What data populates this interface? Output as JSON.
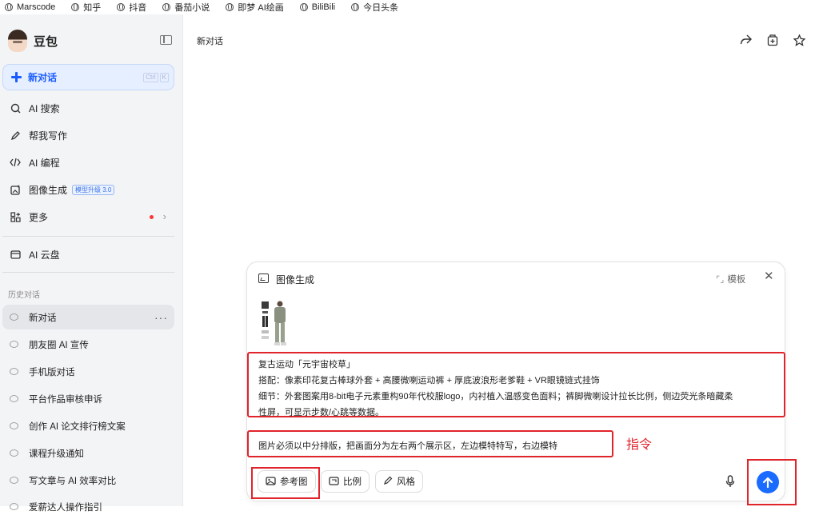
{
  "bookmarks": [
    "Marscode",
    "知乎",
    "抖音",
    "番茄小说",
    "即梦 AI绘画",
    "BiliBili",
    "今日头条"
  ],
  "sidebar": {
    "brand": "豆包",
    "new_chat": {
      "label": "新对话",
      "shortcut_keys": [
        "Ctrl",
        "K"
      ]
    },
    "items": [
      {
        "label": "AI 搜索",
        "icon": "ai-search-icon"
      },
      {
        "label": "帮我写作",
        "icon": "pen-icon"
      },
      {
        "label": "AI 编程",
        "icon": "code-icon"
      },
      {
        "label": "图像生成",
        "icon": "image-gen-icon",
        "badge": "模型升级 3.0"
      },
      {
        "label": "更多",
        "icon": "grid-icon"
      }
    ],
    "cloud": {
      "label": "AI 云盘",
      "icon": "cloud-drive-icon"
    },
    "history_title": "历史对话",
    "history": [
      "新对话",
      "朋友圈 AI 宣传",
      "手机版对话",
      "平台作品审核申诉",
      "创作 AI 论文排行榜文案",
      "课程升级通知",
      "写文章与 AI 效率对比",
      "爱薪达人操作指引"
    ]
  },
  "header": {
    "title": "新对话"
  },
  "composer": {
    "mode_label": "图像生成",
    "template_label": "模板",
    "prompt_lines": [
      "复古运动「元宇宙校草」",
      "搭配：像素印花复古棒球外套 + 高腰微喇运动裤 + 厚底波浪形老爹鞋 + VR眼镜链式挂饰",
      "细节：外套图案用8-bit电子元素重构90年代校服logo，内衬植入温感变色面料；裤脚微喇设计拉长比例，侧边荧光条暗藏柔",
      "性屏，可显示步数/心跳等数据。"
    ],
    "instruction": "图片必须以中分排版，把画面分为左右两个展示区，左边模特特写，右边模特",
    "instruction_annotation": "指令",
    "tools": [
      {
        "label": "参考图",
        "icon": "image-ref-icon"
      },
      {
        "label": "比例",
        "icon": "ratio-icon"
      },
      {
        "label": "风格",
        "icon": "brush-icon"
      }
    ]
  },
  "colors": {
    "accent": "#1a6bff",
    "annotation_red": "#e0242b",
    "sidebar_bg": "#f3f4f6"
  }
}
